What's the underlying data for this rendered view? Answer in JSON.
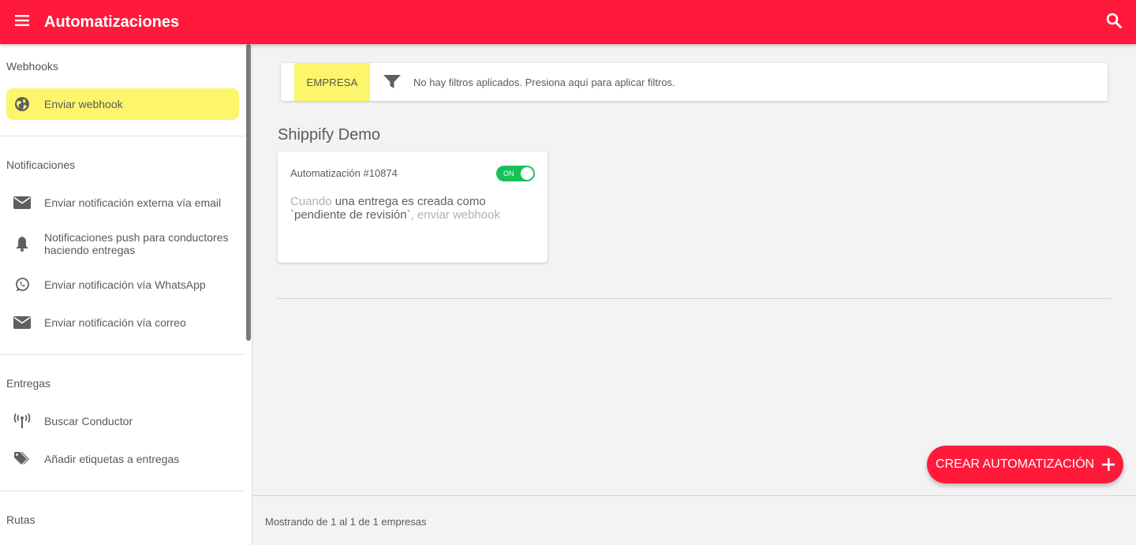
{
  "appbar": {
    "title": "Automatizaciones",
    "menu_icon": "menu-icon",
    "search_icon": "search-icon",
    "color": "#ff1a3c"
  },
  "sidebar": {
    "sections": [
      {
        "title": "Webhooks",
        "items": [
          {
            "label": "Enviar webhook",
            "icon": "globe-icon",
            "active": true
          }
        ]
      },
      {
        "title": "Notificaciones",
        "items": [
          {
            "label": "Enviar notificación externa vía email",
            "icon": "mail-icon"
          },
          {
            "label": "Notificaciones push para conductores haciendo entregas",
            "icon": "bell-icon"
          },
          {
            "label": "Enviar notificación vía WhatsApp",
            "icon": "whatsapp-icon"
          },
          {
            "label": "Enviar notificación vía correo",
            "icon": "mail-icon"
          }
        ]
      },
      {
        "title": "Entregas",
        "items": [
          {
            "label": "Buscar Conductor",
            "icon": "antenna-icon"
          },
          {
            "label": "Añadir etiquetas a entregas",
            "icon": "tags-icon"
          }
        ]
      },
      {
        "title": "Rutas",
        "items": []
      }
    ],
    "active_color": "#fdf56c"
  },
  "filter": {
    "chip": "EMPRESA",
    "icon": "filter-icon",
    "text": "No hay filtros aplicados. Presiona aquí para aplicar filtros."
  },
  "group": {
    "title": "Shippify Demo",
    "card": {
      "id_label": "Automatización #10874",
      "toggle_label": "ON",
      "toggle_on": true,
      "desc_when": "Cuando",
      "desc_event": "una entrega es creada como `pendiente de revisión`",
      "desc_action": ", enviar webhook"
    }
  },
  "fab": {
    "label": "CREAR AUTOMATIZACIÓN",
    "icon": "plus-icon"
  },
  "footer": {
    "text": "Mostrando de 1 al 1 de 1 empresas"
  }
}
